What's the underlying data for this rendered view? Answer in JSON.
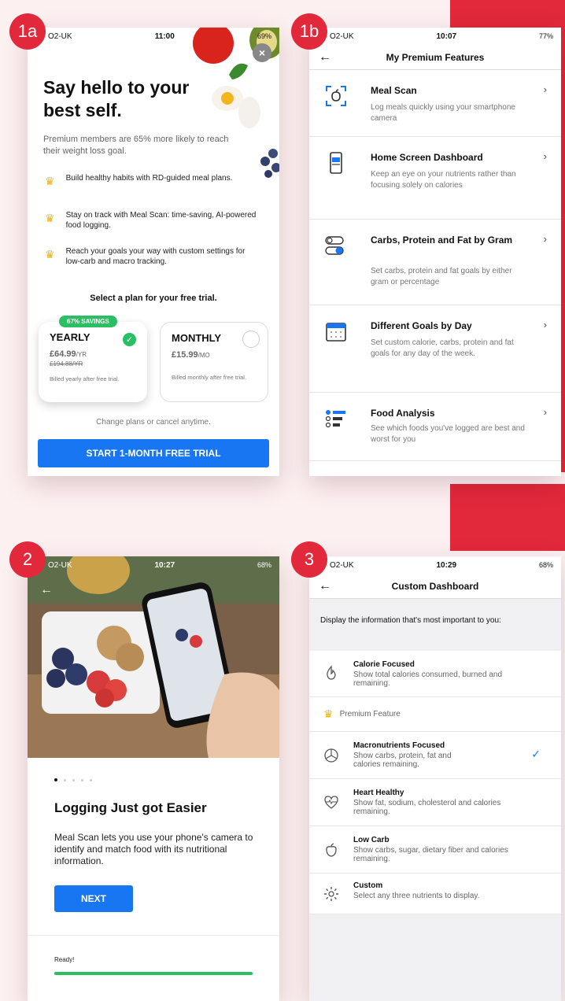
{
  "badges": {
    "b1a": "1a",
    "b1b": "1b",
    "b2": "2",
    "b3": "3"
  },
  "screen1a": {
    "status": {
      "carrier": "O2-UK",
      "time": "11:00",
      "right": "69%"
    },
    "headline": "Say hello to your best self.",
    "subtitle": "Premium members are 65% more likely to reach their weight loss goal.",
    "benefits": [
      "Build healthy habits with RD-guided meal plans.",
      "Stay on track with Meal Scan: time-saving, AI-powered food logging.",
      "Reach your goals your way with custom settings for low-carb and macro tracking."
    ],
    "select_title": "Select a plan for your free trial.",
    "plans": {
      "savings": "67% SAVINGS",
      "yearly": {
        "name": "YEARLY",
        "price": "£64.99",
        "per": "/YR",
        "old": "£194.88",
        "old_per": "/YR",
        "billed": "Billed yearly after free trial."
      },
      "monthly": {
        "name": "MONTHLY",
        "price": "£15.99",
        "per": "/MO",
        "billed": "Billed monthly after free trial."
      }
    },
    "change_text": "Change plans or cancel anytime.",
    "cta": "START 1-MONTH FREE TRIAL",
    "close": "×"
  },
  "screen1b": {
    "status": {
      "carrier": "O2-UK",
      "time": "10:07",
      "right": "77%"
    },
    "back": "←",
    "title": "My Premium Features",
    "features": [
      {
        "title": "Meal Scan",
        "desc": "Log meals quickly using your smartphone camera",
        "icon": "meal-scan-icon"
      },
      {
        "title": "Home Screen Dashboard",
        "desc": "Keep an eye on your nutrients rather than focusing solely on calories",
        "icon": "phone-dashboard-icon"
      },
      {
        "title": "Carbs, Protein and Fat by Gram",
        "desc": "Set carbs, protein and fat goals by either gram or percentage",
        "icon": "toggle-icon"
      },
      {
        "title": "Different Goals by Day",
        "desc": "Set custom calorie, carbs, protein and fat goals for any day of the week.",
        "icon": "calendar-icon"
      },
      {
        "title": "Food Analysis",
        "desc": "See which foods you've logged are best and worst for you",
        "icon": "analysis-list-icon"
      }
    ],
    "chevron": "›"
  },
  "screen2": {
    "status": {
      "carrier": "O2-UK",
      "time": "10:27",
      "right": "68%"
    },
    "back": "←",
    "title": "Logging Just got Easier",
    "body": "Meal Scan lets you use your phone's camera to identify and match food with its nutritional information.",
    "next": "NEXT",
    "ready": "Ready!",
    "progress": 1.0
  },
  "screen3": {
    "status": {
      "carrier": "O2-UK",
      "time": "10:29",
      "right": "68%"
    },
    "back": "←",
    "title": "Custom Dashboard",
    "intro": "Display the information that's most important to you:",
    "calorie": {
      "title": "Calorie Focused",
      "desc": "Show total calories consumed, burned and remaining."
    },
    "premium_label": "Premium Feature",
    "items": [
      {
        "title": "Macronutrients Focused",
        "desc": "Show carbs, protein, fat and calories remaining."
      },
      {
        "title": "Heart Healthy",
        "desc": "Show fat, sodium, cholesterol and calories remaining."
      },
      {
        "title": "Low Carb",
        "desc": "Show carbs, sugar, dietary fiber and calories remaining."
      },
      {
        "title": "Custom",
        "desc": "Select any three nutrients to display."
      }
    ],
    "check": "✓"
  },
  "colors": {
    "brand_red": "#e2283b",
    "cta_blue": "#1876f2",
    "success_green": "#2bbf63",
    "crown_gold": "#f5b400"
  }
}
